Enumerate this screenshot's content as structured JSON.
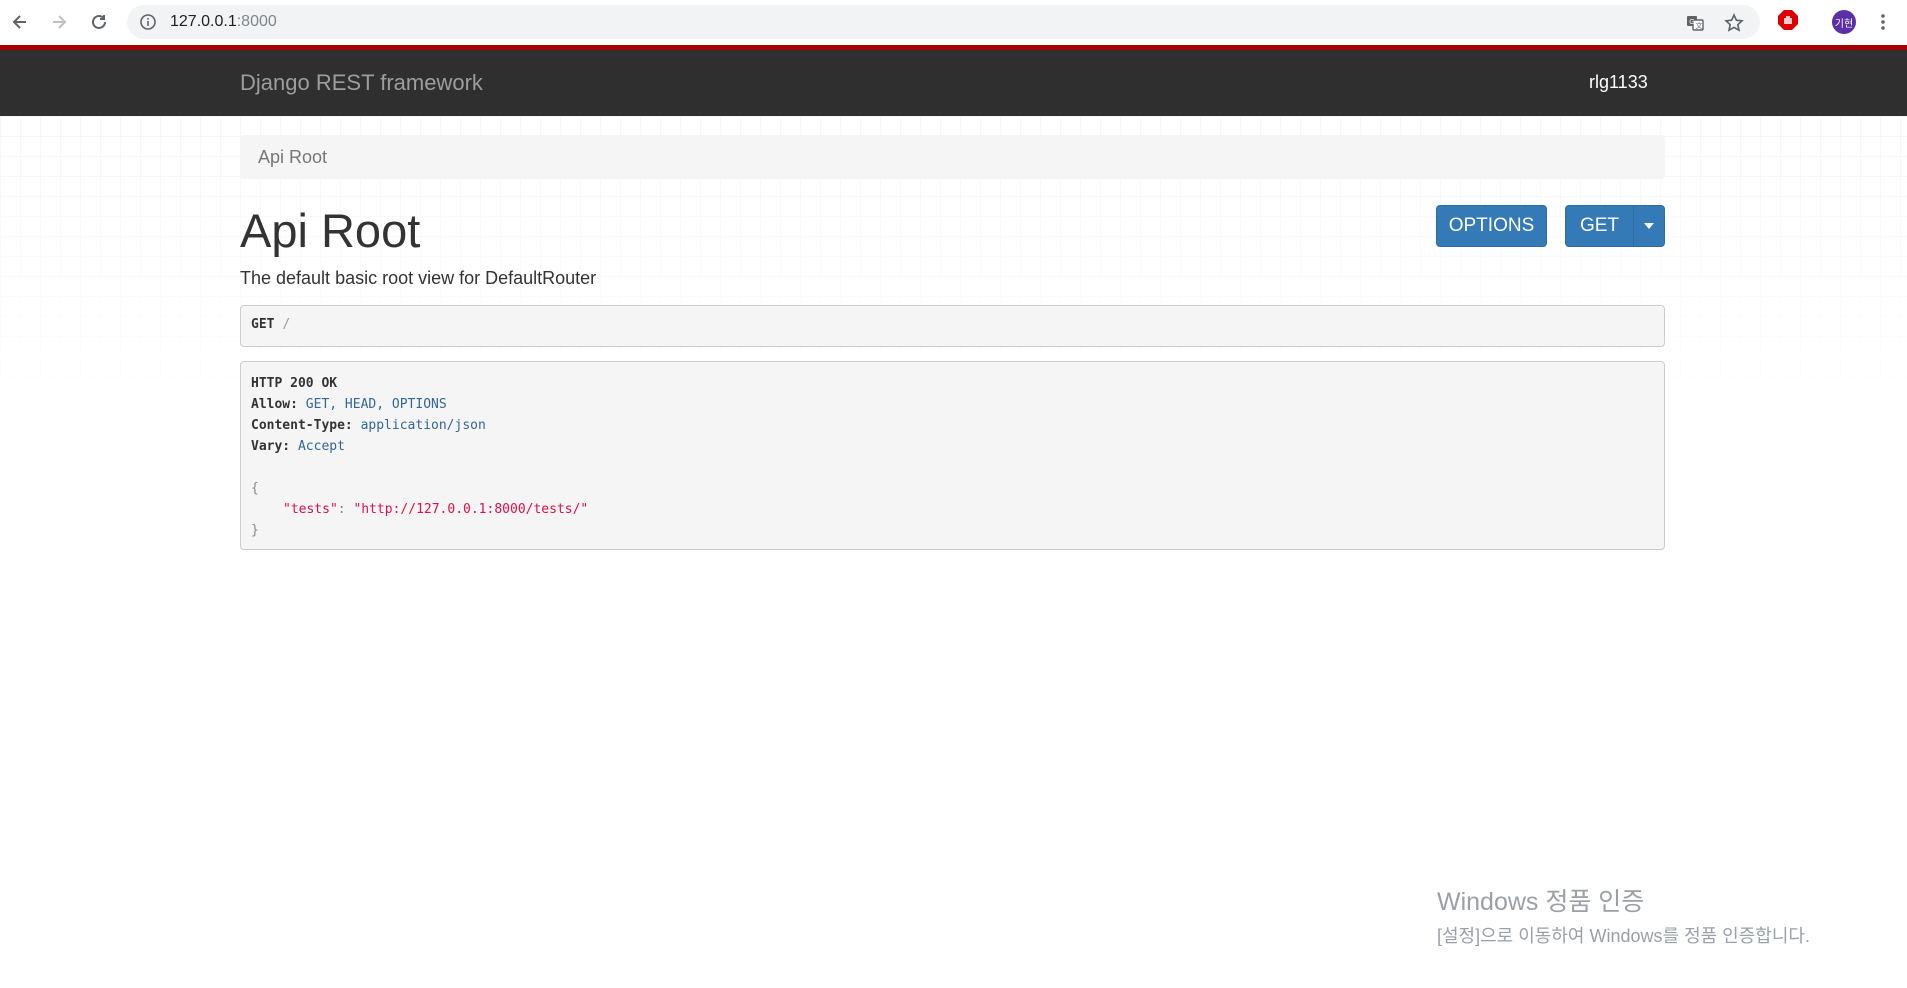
{
  "browser": {
    "url_host": "127.0.0.1",
    "url_port": ":8000",
    "avatar_text": "기현"
  },
  "navbar": {
    "brand": "Django REST framework",
    "user": "rlg1133"
  },
  "breadcrumb": "Api Root",
  "page": {
    "title": "Api Root",
    "description": "The default basic root view for DefaultRouter"
  },
  "buttons": {
    "options": "OPTIONS",
    "get": "GET"
  },
  "request": {
    "method": "GET",
    "path": "/"
  },
  "response": {
    "status": "HTTP 200 OK",
    "headers": [
      {
        "key": "Allow:",
        "value": "GET, HEAD, OPTIONS"
      },
      {
        "key": "Content-Type:",
        "value": "application/json"
      },
      {
        "key": "Vary:",
        "value": "Accept"
      }
    ],
    "open_brace": "{",
    "body_key": "\"tests\"",
    "colon": ":",
    "body_value": "\"http://127.0.0.1:8000/tests/\"",
    "close_brace": "}"
  },
  "watermark": {
    "line1": "Windows 정품 인증",
    "line2": "[설정]으로 이동하여 Windows를 정품 인증합니다."
  },
  "colors": {
    "navbar_bg": "#2f2f2f",
    "accent_red": "#a30000",
    "button_primary": "#337ab7"
  }
}
